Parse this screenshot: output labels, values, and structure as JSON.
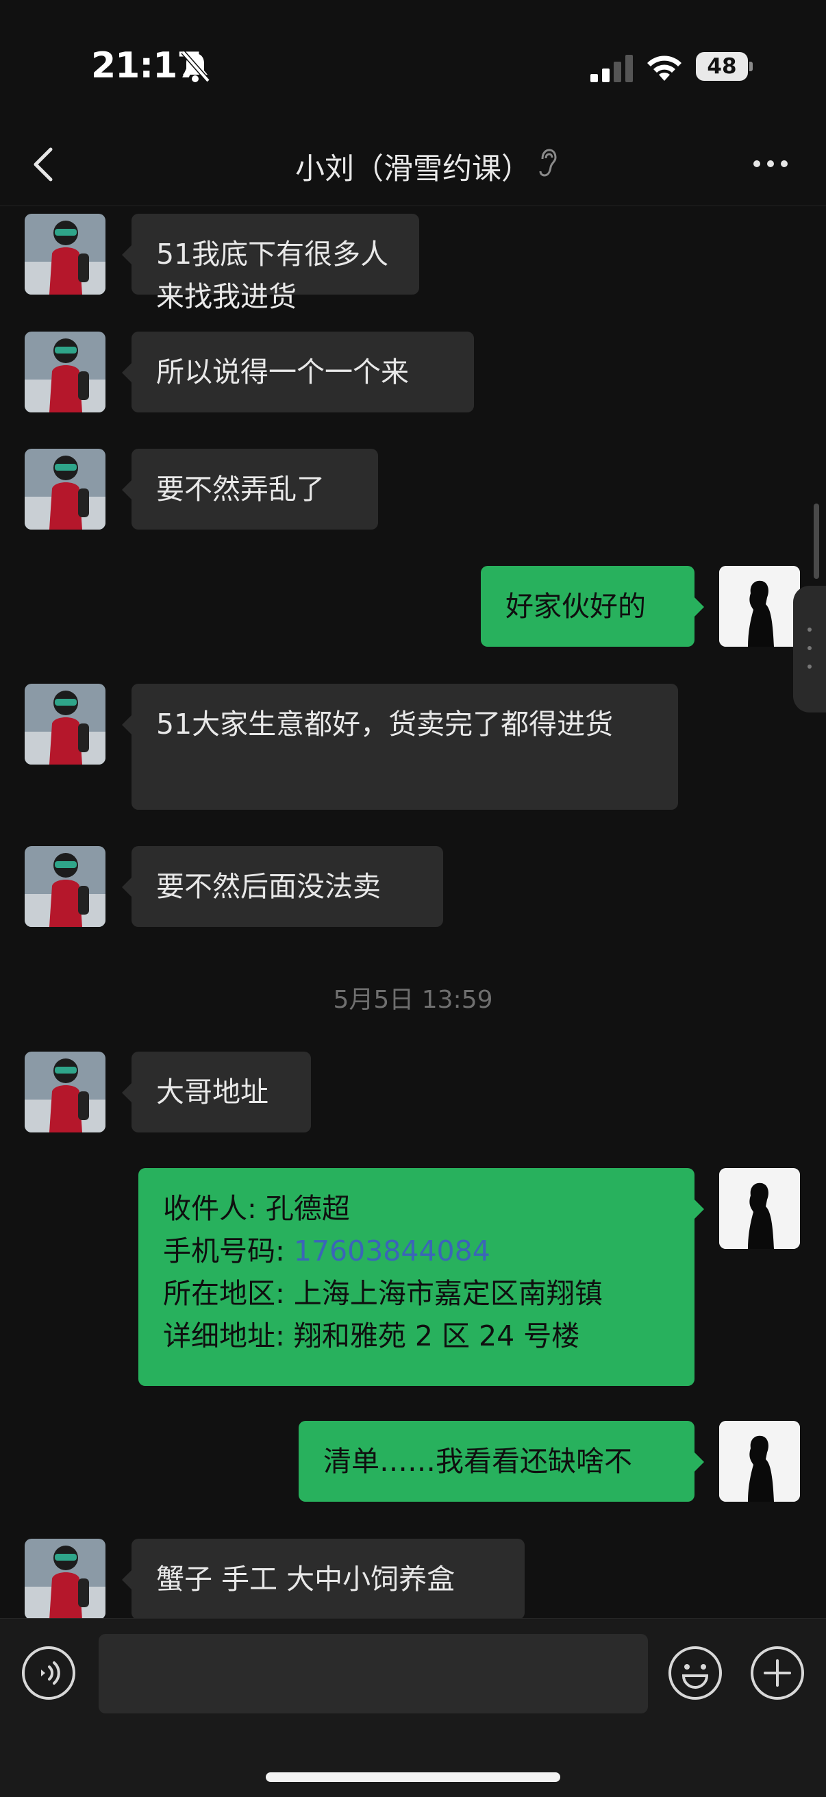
{
  "status_bar": {
    "time": "21:17",
    "battery_level": "48"
  },
  "header": {
    "title": "小刘（滑雪约课）"
  },
  "messages": [
    {
      "side": "in",
      "text": "51我底下有很多人来找我进货"
    },
    {
      "side": "in",
      "text": "所以说得一个一个来"
    },
    {
      "side": "in",
      "text": "要不然弄乱了"
    },
    {
      "side": "out",
      "text": "好家伙好的"
    },
    {
      "side": "in",
      "text": "51大家生意都好，货卖完了都得进货"
    },
    {
      "side": "in",
      "text": "要不然后面没法卖"
    },
    {
      "side": "in",
      "text": "大哥地址"
    },
    {
      "side": "out",
      "address_card": {
        "recipient_label": "收件人: ",
        "recipient": "孔德超",
        "phone_label": "手机号码: ",
        "phone": "17603844084",
        "region_label": "所在地区: ",
        "region": "上海上海市嘉定区南翔镇",
        "detail_label": "详细地址: ",
        "detail": "翔和雅苑 2 区 24 号楼"
      }
    },
    {
      "side": "out",
      "text": "清单……我看看还缺啥不"
    },
    {
      "side": "in",
      "text": "蟹子 手工 大中小饲养盒"
    }
  ],
  "timestamp_1": "5月5日 13:59",
  "colors": {
    "background": "#111111",
    "incoming_bubble": "#2c2c2c",
    "outgoing_bubble": "#28b15d",
    "link": "#3b65b8"
  }
}
